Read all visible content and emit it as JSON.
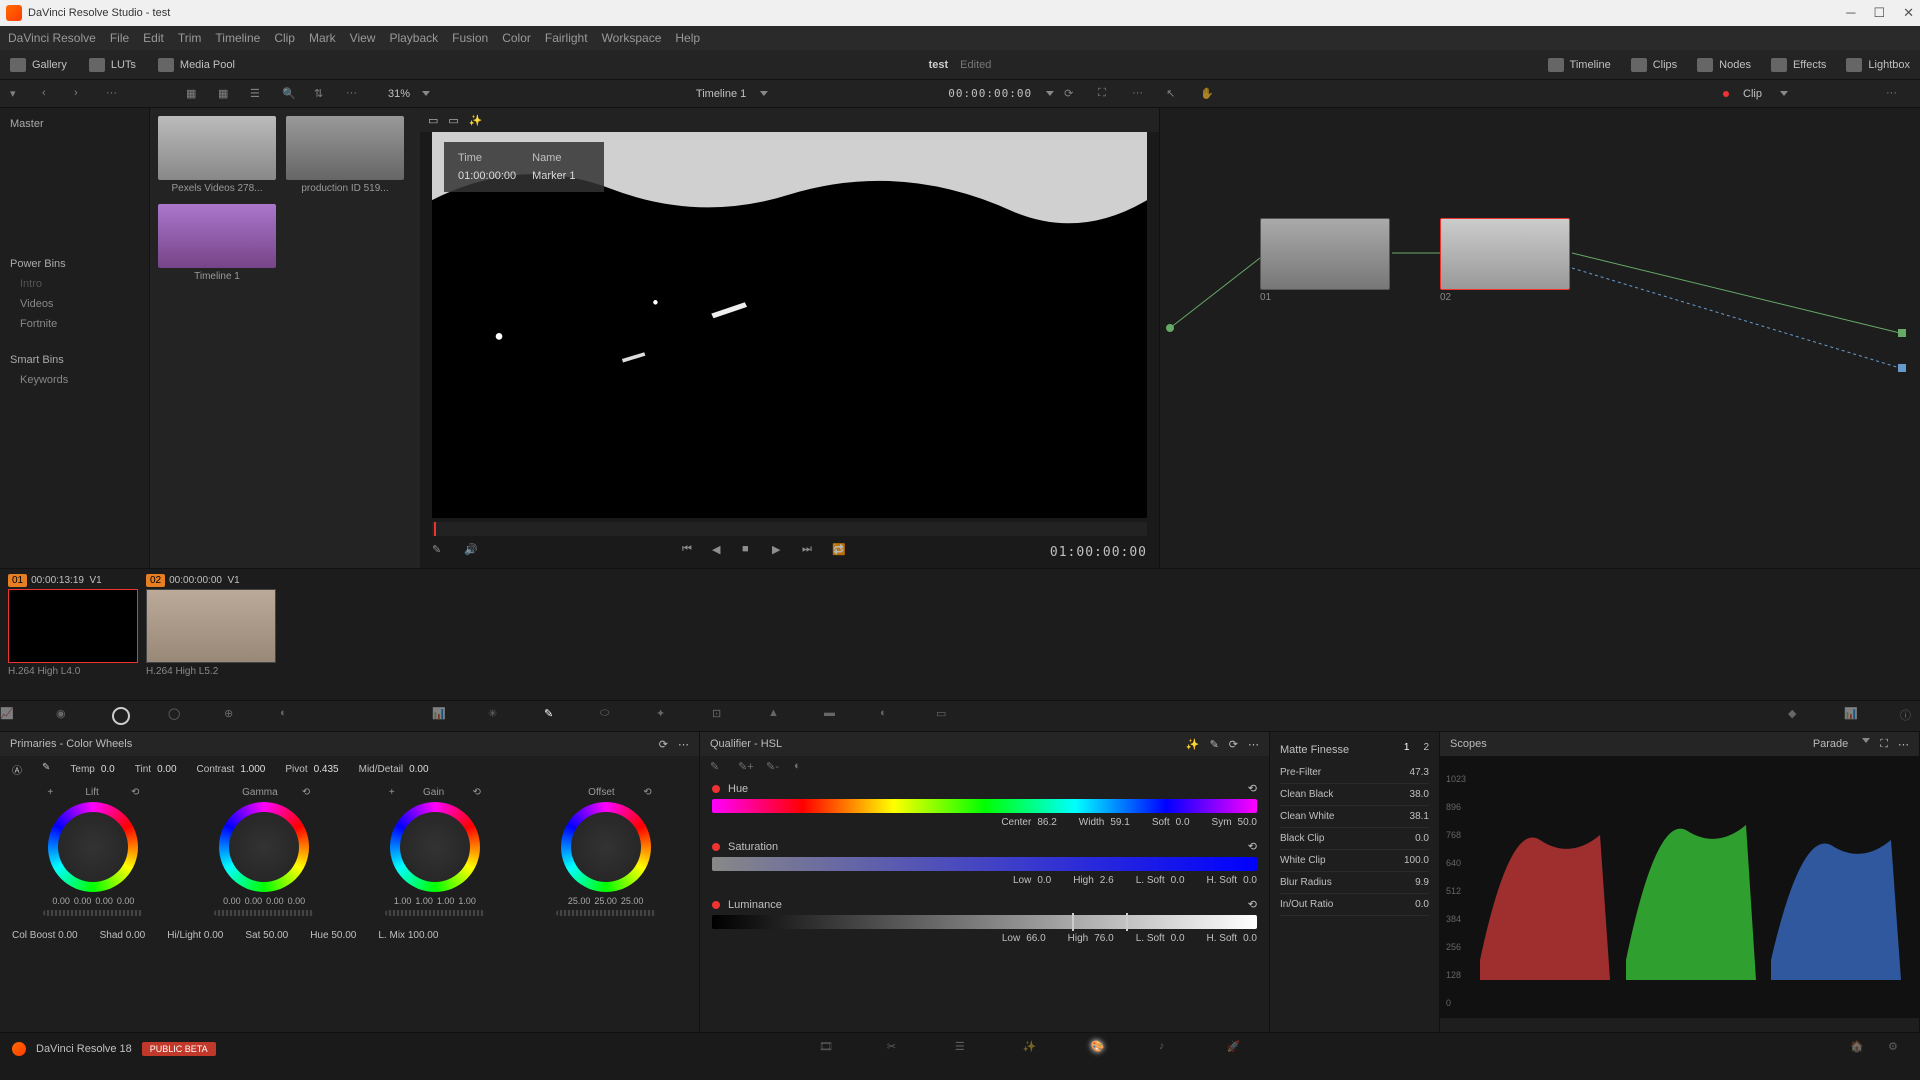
{
  "title": "DaVinci Resolve Studio - test",
  "menu": [
    "DaVinci Resolve",
    "File",
    "Edit",
    "Trim",
    "Timeline",
    "Clip",
    "Mark",
    "View",
    "Playback",
    "Fusion",
    "Color",
    "Fairlight",
    "Workspace",
    "Help"
  ],
  "pagebar": {
    "gallery": "Gallery",
    "luts": "LUTs",
    "media_pool": "Media Pool",
    "project": "test",
    "edited": "Edited",
    "timeline": "Timeline",
    "clips": "Clips",
    "nodes": "Nodes",
    "effects": "Effects",
    "lightbox": "Lightbox"
  },
  "secbar": {
    "zoom": "31%",
    "timeline_name": "Timeline 1",
    "timecode": "00:00:00:00",
    "clip_label": "Clip"
  },
  "sidebar": {
    "master": "Master",
    "power_bins": "Power Bins",
    "intro": "Intro",
    "videos": "Videos",
    "fortnite": "Fortnite",
    "smart_bins": "Smart Bins",
    "keywords": "Keywords"
  },
  "pool_clips": [
    {
      "name": "Pexels Videos 278..."
    },
    {
      "name": "production ID 519..."
    },
    {
      "name": "Timeline 1"
    }
  ],
  "viewer": {
    "overlay": {
      "time_hdr": "Time",
      "name_hdr": "Name",
      "time": "01:00:00:00",
      "name": "Marker 1"
    },
    "tc_right": "01:00:00:00"
  },
  "nodes": {
    "n1": "01",
    "n2": "02"
  },
  "clipstrip": [
    {
      "num": "01",
      "tc": "00:00:13:19",
      "track": "V1",
      "codec": "H.264 High L4.0"
    },
    {
      "num": "02",
      "tc": "00:00:00:00",
      "track": "V1",
      "codec": "H.264 High L5.2"
    }
  ],
  "primaries": {
    "title": "Primaries - Color Wheels",
    "temp": {
      "lbl": "Temp",
      "v": "0.0"
    },
    "tint": {
      "lbl": "Tint",
      "v": "0.00"
    },
    "contrast": {
      "lbl": "Contrast",
      "v": "1.000"
    },
    "pivot": {
      "lbl": "Pivot",
      "v": "0.435"
    },
    "middetail": {
      "lbl": "Mid/Detail",
      "v": "0.00"
    },
    "wheels": [
      {
        "name": "Lift",
        "vals": [
          "0.00",
          "0.00",
          "0.00",
          "0.00"
        ]
      },
      {
        "name": "Gamma",
        "vals": [
          "0.00",
          "0.00",
          "0.00",
          "0.00"
        ]
      },
      {
        "name": "Gain",
        "vals": [
          "1.00",
          "1.00",
          "1.00",
          "1.00"
        ]
      },
      {
        "name": "Offset",
        "vals": [
          "25.00",
          "25.00",
          "25.00"
        ]
      }
    ],
    "col_boost": {
      "lbl": "Col Boost",
      "v": "0.00"
    },
    "shad": {
      "lbl": "Shad",
      "v": "0.00"
    },
    "hilight": {
      "lbl": "Hi/Light",
      "v": "0.00"
    },
    "sat": {
      "lbl": "Sat",
      "v": "50.00"
    },
    "hue": {
      "lbl": "Hue",
      "v": "50.00"
    },
    "lmix": {
      "lbl": "L. Mix",
      "v": "100.00"
    }
  },
  "qualifier": {
    "title": "Qualifier - HSL",
    "hue": {
      "lbl": "Hue",
      "center": {
        "l": "Center",
        "v": "86.2"
      },
      "width": {
        "l": "Width",
        "v": "59.1"
      },
      "soft": {
        "l": "Soft",
        "v": "0.0"
      },
      "sym": {
        "l": "Sym",
        "v": "50.0"
      }
    },
    "sat": {
      "lbl": "Saturation",
      "low": {
        "l": "Low",
        "v": "0.0"
      },
      "high": {
        "l": "High",
        "v": "2.6"
      },
      "lsoft": {
        "l": "L. Soft",
        "v": "0.0"
      },
      "hsoft": {
        "l": "H. Soft",
        "v": "0.0"
      }
    },
    "lum": {
      "lbl": "Luminance",
      "low": {
        "l": "Low",
        "v": "66.0"
      },
      "high": {
        "l": "High",
        "v": "76.0"
      },
      "lsoft": {
        "l": "L. Soft",
        "v": "0.0"
      },
      "hsoft": {
        "l": "H. Soft",
        "v": "0.0"
      }
    }
  },
  "matte": {
    "title": "Matte Finesse",
    "tab1": "1",
    "tab2": "2",
    "rows": [
      {
        "l": "Pre-Filter",
        "v": "47.3"
      },
      {
        "l": "Clean Black",
        "v": "38.0"
      },
      {
        "l": "Clean White",
        "v": "38.1"
      },
      {
        "l": "Black Clip",
        "v": "0.0"
      },
      {
        "l": "White Clip",
        "v": "100.0"
      },
      {
        "l": "Blur Radius",
        "v": "9.9"
      },
      {
        "l": "In/Out Ratio",
        "v": "0.0"
      }
    ]
  },
  "scopes": {
    "title": "Scopes",
    "mode": "Parade",
    "scale": [
      "1023",
      "896",
      "768",
      "640",
      "512",
      "384",
      "256",
      "128",
      "0"
    ]
  },
  "navbar": {
    "resolve": "DaVinci Resolve 18",
    "beta": "PUBLIC BETA"
  }
}
